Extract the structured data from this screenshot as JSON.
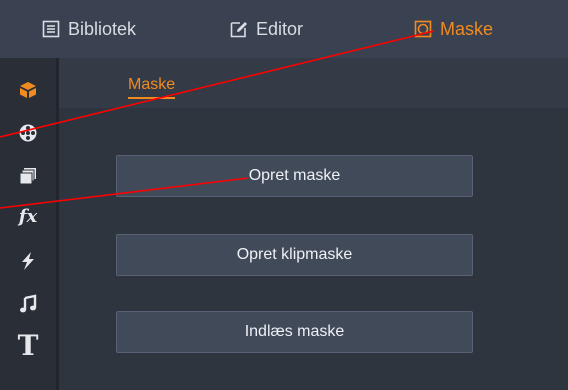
{
  "topbar": {
    "tabs": [
      {
        "label": "Bibliotek",
        "icon": "library-icon"
      },
      {
        "label": "Editor",
        "icon": "edit-icon"
      },
      {
        "label": "Maske",
        "icon": "mask-icon"
      }
    ],
    "active_tab": "Maske"
  },
  "sidebar": {
    "icons": [
      "box-icon",
      "film-reel-icon",
      "stack-icon",
      "fx-icon",
      "lightning-icon",
      "music-note-icon",
      "title-icon"
    ],
    "fx_label": "fx",
    "title_label": "T"
  },
  "subheader": {
    "tab_label": "Maske"
  },
  "content": {
    "buttons": [
      {
        "label": "Opret maske"
      },
      {
        "label": "Opret klipmaske"
      },
      {
        "label": "Indlæs maske"
      }
    ]
  },
  "colors": {
    "accent": "#f08b20",
    "annotation": "#ff0000",
    "topbar": "#3a4150",
    "button": "#414a59"
  }
}
